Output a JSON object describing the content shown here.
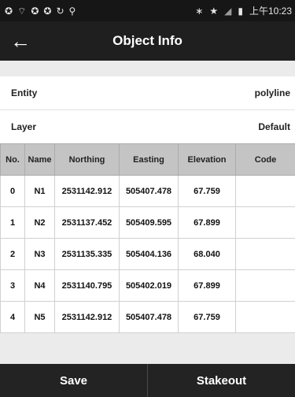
{
  "statusbar": {
    "left_icons": [
      "sync-icon",
      "wifi-signal-icon",
      "sync-icon",
      "sync-icon",
      "circle-arrow-icon",
      "location-pin-icon"
    ],
    "time": "上午10:23"
  },
  "appbar": {
    "title": "Object Info"
  },
  "info": {
    "entity_label": "Entity",
    "entity_value": "polyline",
    "layer_label": "Layer",
    "layer_value": "Default"
  },
  "table": {
    "headers": [
      "No.",
      "Name",
      "Northing",
      "Easting",
      "Elevation",
      "Code"
    ],
    "rows": [
      [
        "0",
        "N1",
        "2531142.912",
        "505407.478",
        "67.759",
        ""
      ],
      [
        "1",
        "N2",
        "2531137.452",
        "505409.595",
        "67.899",
        ""
      ],
      [
        "2",
        "N3",
        "2531135.335",
        "505404.136",
        "68.040",
        ""
      ],
      [
        "3",
        "N4",
        "2531140.795",
        "505402.019",
        "67.899",
        ""
      ],
      [
        "4",
        "N5",
        "2531142.912",
        "505407.478",
        "67.759",
        ""
      ]
    ]
  },
  "bottombar": {
    "save_label": "Save",
    "stakeout_label": "Stakeout"
  }
}
